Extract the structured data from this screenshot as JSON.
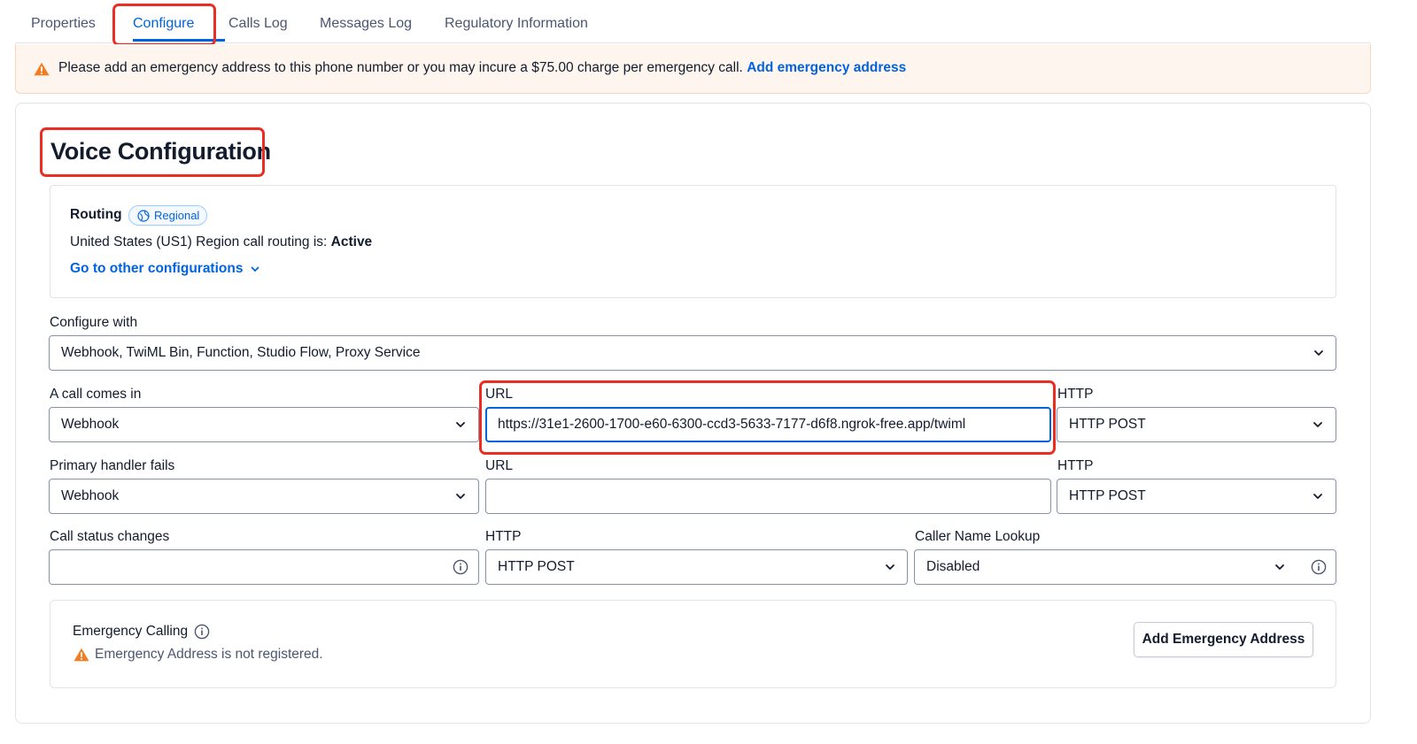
{
  "tabs": [
    {
      "label": "Properties"
    },
    {
      "label": "Configure"
    },
    {
      "label": "Calls Log"
    },
    {
      "label": "Messages Log"
    },
    {
      "label": "Regulatory Information"
    }
  ],
  "active_tab": "Configure",
  "banner": {
    "text": "Please add an emergency address to this phone number or you may incure a $75.00 charge per emergency call.",
    "link": "Add emergency address"
  },
  "voice": {
    "title": "Voice Configuration",
    "routing": {
      "title": "Routing",
      "badge": "Regional",
      "status_prefix": "United States (US1) Region call routing is:",
      "status_value": "Active",
      "other_link": "Go to other configurations"
    },
    "configure_with": {
      "label": "Configure with",
      "value": "Webhook, TwiML Bin, Function, Studio Flow, Proxy Service"
    },
    "call_comes_in": {
      "label": "A call comes in",
      "type": "Webhook",
      "url_label": "URL",
      "url": "https://31e1-2600-1700-e60-6300-ccd3-5633-7177-d6f8.ngrok-free.app/twiml",
      "http_label": "HTTP",
      "http": "HTTP POST"
    },
    "primary_fails": {
      "label": "Primary handler fails",
      "type": "Webhook",
      "url_label": "URL",
      "url": "",
      "http_label": "HTTP",
      "http": "HTTP POST"
    },
    "status_changes": {
      "label": "Call status changes",
      "value": "",
      "http_label": "HTTP",
      "http": "HTTP POST",
      "lookup_label": "Caller Name Lookup",
      "lookup": "Disabled"
    },
    "emergency": {
      "title": "Emergency Calling",
      "status": "Emergency Address is not registered.",
      "button": "Add Emergency Address"
    }
  },
  "colors": {
    "accent": "#0263e0",
    "warning": "#f47c22",
    "highlight": "#ea2e24"
  }
}
